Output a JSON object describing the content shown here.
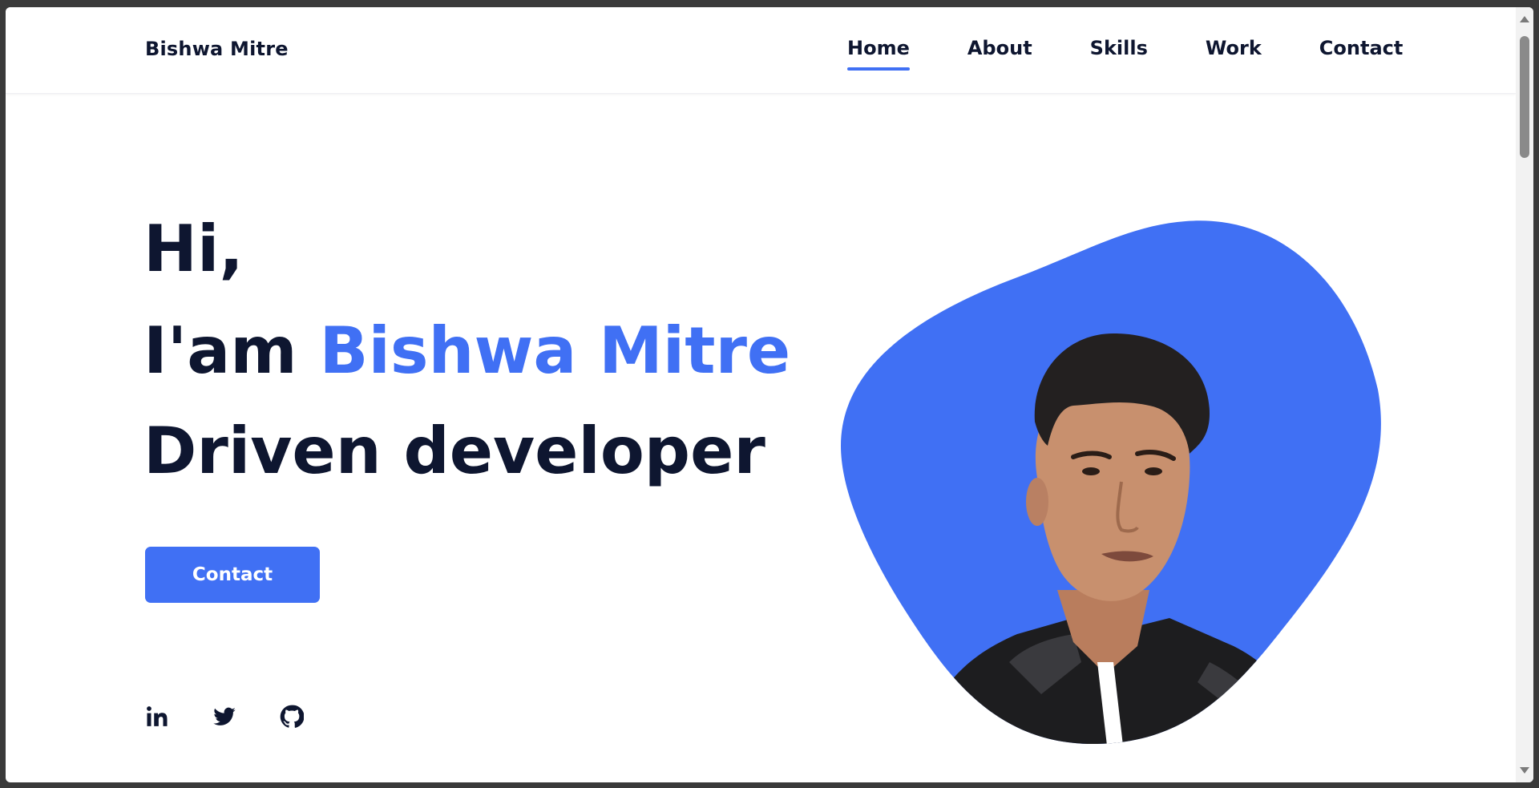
{
  "brand": {
    "name": "Bishwa Mitre"
  },
  "nav": {
    "items": [
      {
        "label": "Home",
        "active": true
      },
      {
        "label": "About",
        "active": false
      },
      {
        "label": "Skills",
        "active": false
      },
      {
        "label": "Work",
        "active": false
      },
      {
        "label": "Contact",
        "active": false
      }
    ]
  },
  "hero": {
    "greeting": "Hi,",
    "intro": "I'am",
    "name": "Bishwa Mitre",
    "role": "Driven developer",
    "button_label": "Contact"
  },
  "socials": {
    "icons": [
      "linkedin-icon",
      "twitter-icon",
      "github-icon"
    ]
  },
  "colors": {
    "accent": "#4070f4",
    "text": "#0e1630",
    "background": "#ffffff"
  }
}
